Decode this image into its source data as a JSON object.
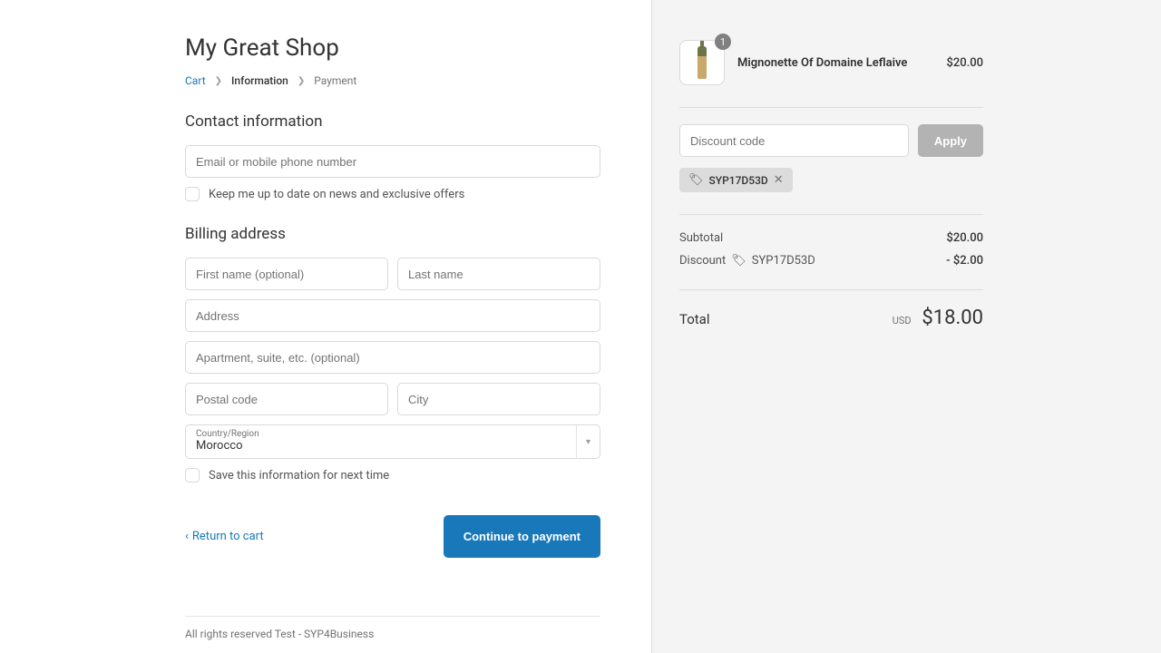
{
  "shop": {
    "title": "My Great Shop"
  },
  "breadcrumb": {
    "cart": "Cart",
    "information": "Information",
    "payment": "Payment"
  },
  "contact": {
    "heading": "Contact information",
    "email_placeholder": "Email or mobile phone number",
    "newsletter_label": "Keep me up to date on news and exclusive offers"
  },
  "billing": {
    "heading": "Billing address",
    "first_name_placeholder": "First name (optional)",
    "last_name_placeholder": "Last name",
    "address_placeholder": "Address",
    "apartment_placeholder": "Apartment, suite, etc. (optional)",
    "postal_placeholder": "Postal code",
    "city_placeholder": "City",
    "country_label": "Country/Region",
    "country_value": "Morocco",
    "save_label": "Save this information for next time"
  },
  "actions": {
    "return_label": "Return to cart",
    "continue_label": "Continue to payment"
  },
  "footer": {
    "text": "All rights reserved Test - SYP4Business"
  },
  "cart": {
    "item": {
      "name": "Mignonette Of Domaine Leflaive",
      "price": "$20.00",
      "qty": "1"
    },
    "discount_placeholder": "Discount code",
    "apply_label": "Apply",
    "applied_code": "SYP17D53D",
    "subtotal_label": "Subtotal",
    "subtotal_value": "$20.00",
    "discount_label": "Discount",
    "discount_code": "SYP17D53D",
    "discount_value": "- $2.00",
    "total_label": "Total",
    "currency": "USD",
    "total_value": "$18.00"
  }
}
